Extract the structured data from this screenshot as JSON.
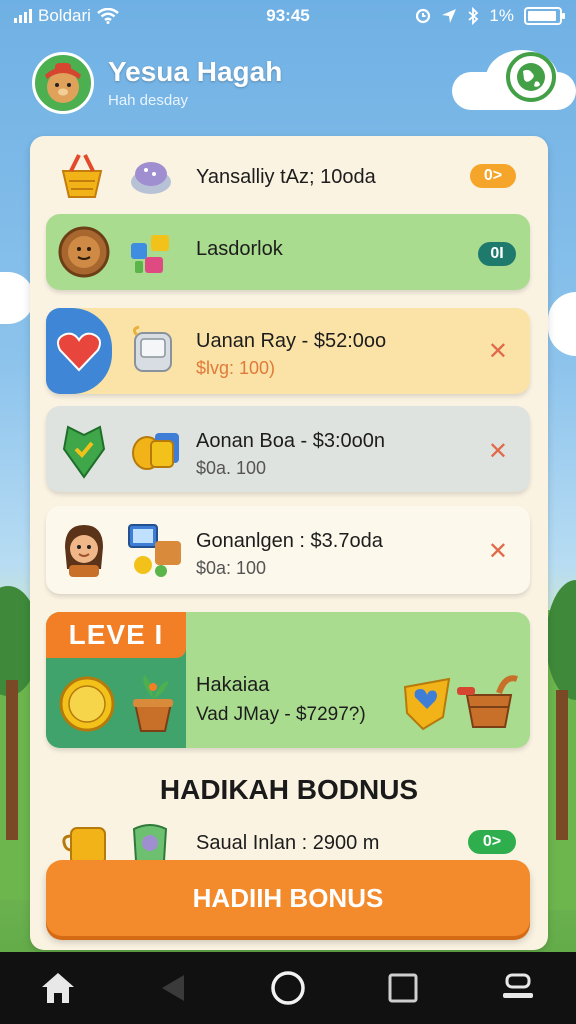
{
  "status_bar": {
    "carrier": "Boldari",
    "time": "93:45",
    "battery_text": "1%"
  },
  "header": {
    "user_name": "Yesua Hagah",
    "user_subtitle": "Hah desday"
  },
  "rows": [
    {
      "title": "Yansalliy tAz; 10oda",
      "badge": "0>"
    },
    {
      "title": "Lasdorlok",
      "badge": "0I"
    },
    {
      "title": "Uanan Ray - $52:0oo",
      "subtitle": "$lvg: 100)"
    },
    {
      "title": "Aonan Boa - $3:0o0n",
      "subtitle": "$0a. 100"
    },
    {
      "title": "Gonanlgen : $3.7oda",
      "subtitle": "$0a: 100"
    }
  ],
  "level_card": {
    "tag": "LEVE I",
    "title": "Hakaiaa",
    "subtitle": "Vad JMay - $7297?)"
  },
  "bonus": {
    "heading": "HADIKAH BODNUS",
    "row_title": "Saual Inlan : 2900 m",
    "row_badge": "0>",
    "button_label": "HADIIH BONUS"
  },
  "colors": {
    "accent_orange": "#f38a2c",
    "green_row": "#a9dc8f",
    "yellow_row": "#fbe2a6",
    "gray_row": "#dfe3df",
    "badge_orange": "#f4a52a",
    "badge_teal": "#1f7a6e",
    "badge_green": "#2fae4e",
    "close_red": "#e06a4a"
  },
  "icons": {
    "nav": [
      "home-icon",
      "back-icon",
      "circle-home-icon",
      "recents-icon",
      "menu-icon"
    ]
  }
}
